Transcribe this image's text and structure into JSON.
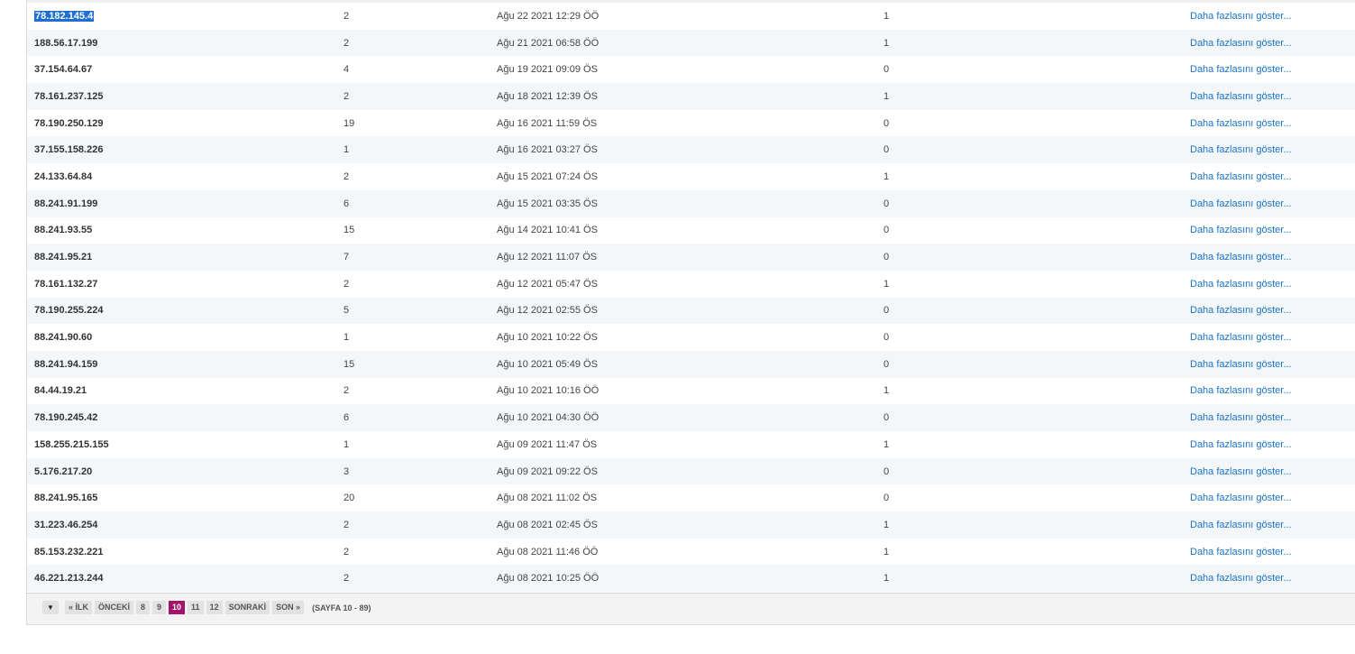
{
  "rows": [
    {
      "ip": "78.182.145.4",
      "count": "2",
      "date": "Ağu 22 2021 12:29 ÖÖ",
      "flag": "1",
      "more": "Daha fazlasını göster..."
    },
    {
      "ip": "188.56.17.199",
      "count": "2",
      "date": "Ağu 21 2021 06:58 ÖÖ",
      "flag": "1",
      "more": "Daha fazlasını göster..."
    },
    {
      "ip": "37.154.64.67",
      "count": "4",
      "date": "Ağu 19 2021 09:09 ÖS",
      "flag": "0",
      "more": "Daha fazlasını göster..."
    },
    {
      "ip": "78.161.237.125",
      "count": "2",
      "date": "Ağu 18 2021 12:39 ÖS",
      "flag": "1",
      "more": "Daha fazlasını göster..."
    },
    {
      "ip": "78.190.250.129",
      "count": "19",
      "date": "Ağu 16 2021 11:59 ÖS",
      "flag": "0",
      "more": "Daha fazlasını göster..."
    },
    {
      "ip": "37.155.158.226",
      "count": "1",
      "date": "Ağu 16 2021 03:27 ÖS",
      "flag": "0",
      "more": "Daha fazlasını göster..."
    },
    {
      "ip": "24.133.64.84",
      "count": "2",
      "date": "Ağu 15 2021 07:24 ÖS",
      "flag": "1",
      "more": "Daha fazlasını göster..."
    },
    {
      "ip": "88.241.91.199",
      "count": "6",
      "date": "Ağu 15 2021 03:35 ÖS",
      "flag": "0",
      "more": "Daha fazlasını göster..."
    },
    {
      "ip": "88.241.93.55",
      "count": "15",
      "date": "Ağu 14 2021 10:41 ÖS",
      "flag": "0",
      "more": "Daha fazlasını göster..."
    },
    {
      "ip": "88.241.95.21",
      "count": "7",
      "date": "Ağu 12 2021 11:07 ÖS",
      "flag": "0",
      "more": "Daha fazlasını göster..."
    },
    {
      "ip": "78.161.132.27",
      "count": "2",
      "date": "Ağu 12 2021 05:47 ÖS",
      "flag": "1",
      "more": "Daha fazlasını göster..."
    },
    {
      "ip": "78.190.255.224",
      "count": "5",
      "date": "Ağu 12 2021 02:55 ÖS",
      "flag": "0",
      "more": "Daha fazlasını göster..."
    },
    {
      "ip": "88.241.90.60",
      "count": "1",
      "date": "Ağu 10 2021 10:22 ÖS",
      "flag": "0",
      "more": "Daha fazlasını göster..."
    },
    {
      "ip": "88.241.94.159",
      "count": "15",
      "date": "Ağu 10 2021 05:49 ÖS",
      "flag": "0",
      "more": "Daha fazlasını göster..."
    },
    {
      "ip": "84.44.19.21",
      "count": "2",
      "date": "Ağu 10 2021 10:16 ÖÖ",
      "flag": "1",
      "more": "Daha fazlasını göster..."
    },
    {
      "ip": "78.190.245.42",
      "count": "6",
      "date": "Ağu 10 2021 04:30 ÖÖ",
      "flag": "0",
      "more": "Daha fazlasını göster..."
    },
    {
      "ip": "158.255.215.155",
      "count": "1",
      "date": "Ağu 09 2021 11:47 ÖS",
      "flag": "1",
      "more": "Daha fazlasını göster..."
    },
    {
      "ip": "5.176.217.20",
      "count": "3",
      "date": "Ağu 09 2021 09:22 ÖS",
      "flag": "0",
      "more": "Daha fazlasını göster..."
    },
    {
      "ip": "88.241.95.165",
      "count": "20",
      "date": "Ağu 08 2021 11:02 ÖS",
      "flag": "0",
      "more": "Daha fazlasını göster..."
    },
    {
      "ip": "31.223.46.254",
      "count": "2",
      "date": "Ağu 08 2021 02:45 ÖS",
      "flag": "1",
      "more": "Daha fazlasını göster..."
    },
    {
      "ip": "85.153.232.221",
      "count": "2",
      "date": "Ağu 08 2021 11:46 ÖÖ",
      "flag": "1",
      "more": "Daha fazlasını göster..."
    },
    {
      "ip": "46.221.213.244",
      "count": "2",
      "date": "Ağu 08 2021 10:25 ÖÖ",
      "flag": "1",
      "more": "Daha fazlasını göster..."
    }
  ],
  "pagination": {
    "dropdown_icon": "triangle-down-icon",
    "first": "« İLK",
    "prev": "ÖNCEKİ",
    "pages": [
      "8",
      "9",
      "10",
      "11",
      "12"
    ],
    "current": "10",
    "next": "SONRAKİ",
    "last": "SON »",
    "info": "(SAYFA 10 - 89)"
  },
  "colors": {
    "link": "#1a73c7",
    "active_page": "#a1166a",
    "selection": "#1f6fd0",
    "row_alt": "#f4f7fa"
  }
}
